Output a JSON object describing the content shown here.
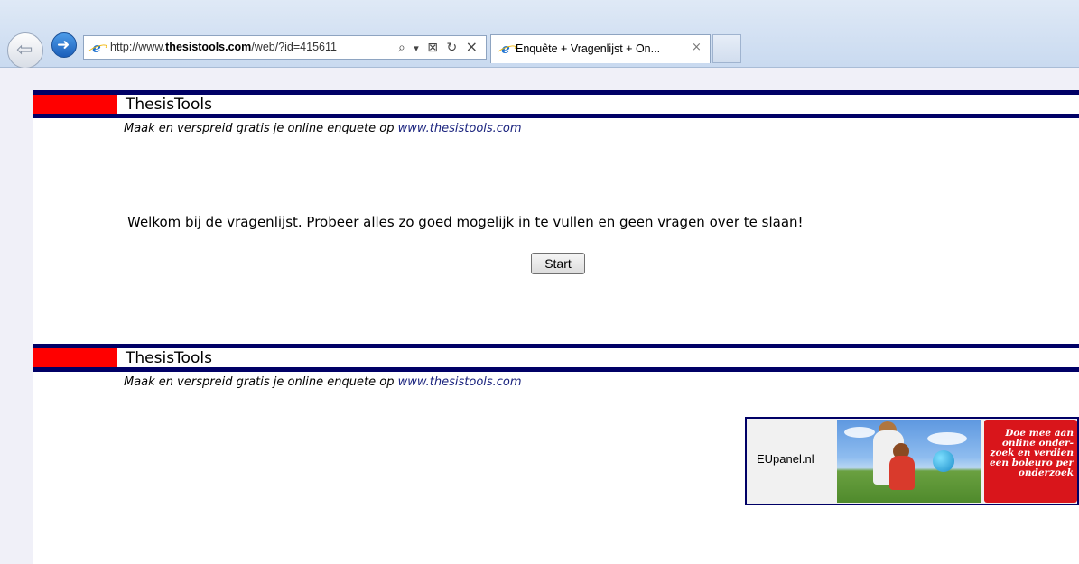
{
  "browser": {
    "url_prefix": "http://www.",
    "url_domain": "thesistools.com",
    "url_path": "/web/?id=415611",
    "tab_title": "Enquête + Vragenlijst + On...",
    "tab_close": "×",
    "back_icon": "back-arrow-icon",
    "forward_icon": "forward-arrow-icon",
    "search_icon": "⌕",
    "dropdown_icon": "▾",
    "compat_icon": "⊠",
    "refresh_icon": "↻",
    "stop_icon": "×"
  },
  "header_banner": {
    "title": "ThesisTools",
    "tagline_text": "Maak en verspreid gratis je online enquete op ",
    "tagline_link": "www.thesistools.com"
  },
  "main": {
    "welcome_text": "Welkom bij de vragenlijst. Probeer alles zo goed mogelijk in te vullen en geen vragen over te slaan!",
    "start_label": "Start"
  },
  "footer_banner": {
    "title": "ThesisTools",
    "tagline_text": "Maak en verspreid gratis je online enquete op ",
    "tagline_link": "www.thesistools.com"
  },
  "ad": {
    "label": "EUpanel.nl",
    "slogan": "Doe mee aan\nonline onder-\nzoek en verdien\neen boleuro per\nonderzoek"
  },
  "colors": {
    "banner_navy": "#000066",
    "banner_red": "#ff0000",
    "link": "#1a237e",
    "ad_red": "#d9151b",
    "page_gutter": "#f0f0f8"
  }
}
